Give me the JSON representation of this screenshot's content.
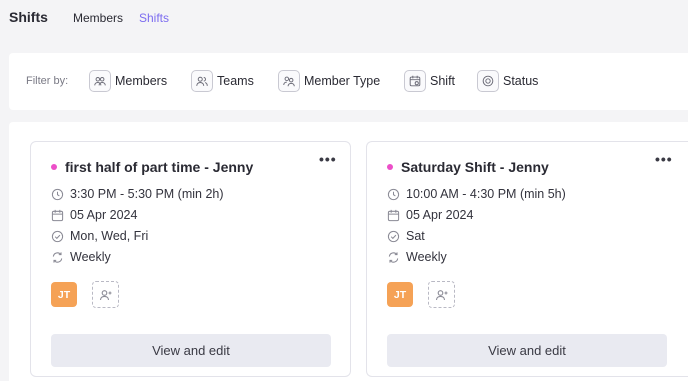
{
  "header": {
    "title": "Shifts",
    "tabs": [
      {
        "label": "Members",
        "active": false
      },
      {
        "label": "Shifts",
        "active": true
      }
    ]
  },
  "filters": {
    "label": "Filter by:",
    "items": [
      {
        "label": "Members",
        "icon": "members-icon"
      },
      {
        "label": "Teams",
        "icon": "teams-icon"
      },
      {
        "label": "Member Type",
        "icon": "member-type-icon"
      },
      {
        "label": "Shift",
        "icon": "calendar-icon"
      },
      {
        "label": "Status",
        "icon": "status-icon"
      }
    ]
  },
  "cards": [
    {
      "title": "first half of part time - Jenny",
      "time": "3:30 PM - 5:30 PM (min 2h)",
      "date": "05 Apr 2024",
      "days": "Mon, Wed, Fri",
      "repeat": "Weekly",
      "avatar_initials": "JT",
      "action_label": "View and edit"
    },
    {
      "title": "Saturday Shift - Jenny",
      "time": "10:00 AM - 4:30 PM (min 5h)",
      "date": "05 Apr 2024",
      "days": "Sat",
      "repeat": "Weekly",
      "avatar_initials": "JT",
      "action_label": "View and edit"
    }
  ],
  "more_label": "•••",
  "colors": {
    "accent": "#7c6cf0",
    "status_dot": "#ec4fc8",
    "avatar_bg": "#f5a256",
    "button_bg": "#e9eaf1"
  }
}
